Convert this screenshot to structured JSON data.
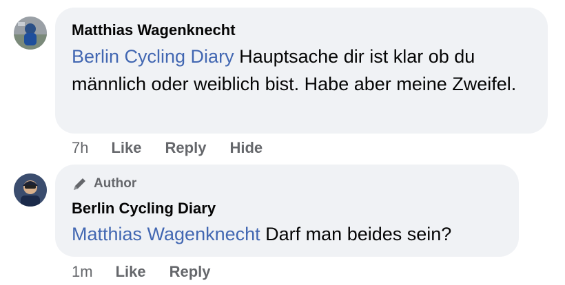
{
  "comments": [
    {
      "author": "Matthias Wagenknecht",
      "mention": "Berlin Cycling Diary",
      "text": "Hauptsache dir ist klar ob du männlich oder weiblich bist. Habe aber meine Zweifel.",
      "time": "7h",
      "actions": [
        "Like",
        "Reply",
        "Hide"
      ]
    },
    {
      "badge": "Author",
      "badge_icon": "pencil-icon",
      "author": "Berlin Cycling Diary",
      "mention": "Matthias Wagenknecht",
      "text": "Darf man beides sein?",
      "time": "1m",
      "actions": [
        "Like",
        "Reply"
      ]
    }
  ],
  "colors": {
    "bubble": "#f0f2f5",
    "mention": "#4267b2",
    "meta": "#65676b",
    "text": "#050505"
  }
}
